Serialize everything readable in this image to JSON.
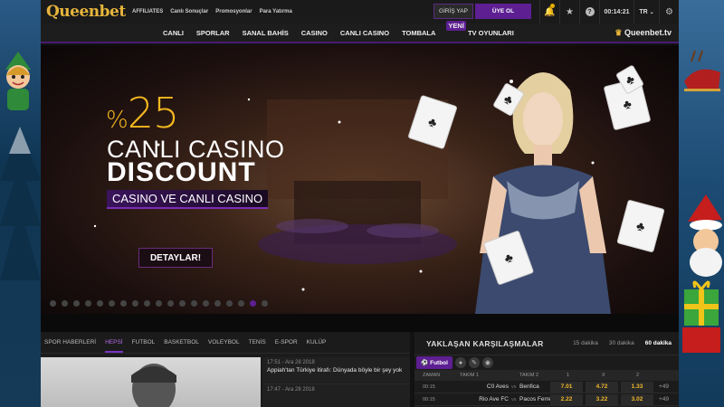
{
  "brand": {
    "logo": "Queenbet",
    "tv_logo": "Queenbet.tv"
  },
  "toplinks": [
    "AFFILIATES",
    "Canlı Sonuçlar",
    "Promosyonlar",
    "Para Yatırma"
  ],
  "auth": {
    "login": "GİRİŞ YAP",
    "register": "ÜYE OL"
  },
  "tools": {
    "time": "00:14:21",
    "lang": "TR"
  },
  "nav": {
    "items": [
      "CANLI",
      "SPORLAR",
      "SANAL BAHİS",
      "CASINO",
      "CANLI CASINO",
      "TOMBALA",
      "TV OYUNLARI"
    ],
    "badge": "YENİ"
  },
  "hero": {
    "percent_sign": "%",
    "percent": "25",
    "line1": "CANLI CASINO",
    "line2": "DISCOUNT",
    "line3": "CASINO VE CANLI CASINO",
    "button": "DETAYLAR!",
    "slides_total": 19,
    "slide_active": 17
  },
  "news": {
    "tabs": [
      "SPOR HABERLERİ",
      "HEPSİ",
      "FUTBOL",
      "BASKETBOL",
      "VOLEYBOL",
      "TENİS",
      "E-SPOR",
      "KULÜP"
    ],
    "active_tab": "HEPSİ",
    "items": [
      {
        "time": "17:51 - Ara 28 2018",
        "headline": "Appiah'tan Türkiye itirafı: Dünyada böyle bir şey yok"
      },
      {
        "time": "17:47 - Ara 28 2018",
        "headline": ""
      }
    ]
  },
  "matches": {
    "title": "YAKLAŞAN KARŞILAŞMALAR",
    "filters": [
      "15 dakika",
      "30 dakika",
      "60 dakika"
    ],
    "active_filter": "60 dakika",
    "sport_tab": "Futbol",
    "columns": {
      "time": "ZAMAN",
      "team1": "TAKIM 1",
      "team2": "TAKIM 2",
      "c1": "1",
      "cx": "X",
      "c2": "2"
    },
    "rows": [
      {
        "time": "00:15",
        "team1": "C0 Aves",
        "vs": "vs",
        "team2": "Benfica",
        "o1": "7.01",
        "ox": "4.72",
        "o2": "1.33",
        "more": "+49"
      },
      {
        "time": "00:15",
        "team1": "Rio Ave FC",
        "vs": "vs",
        "team2": "Pacos Ferreira",
        "o1": "2.22",
        "ox": "3.22",
        "o2": "3.02",
        "more": "+49"
      }
    ]
  },
  "colors": {
    "accent": "#5d1f92",
    "gold": "#f5b81f",
    "odds": "#f2b92a"
  }
}
